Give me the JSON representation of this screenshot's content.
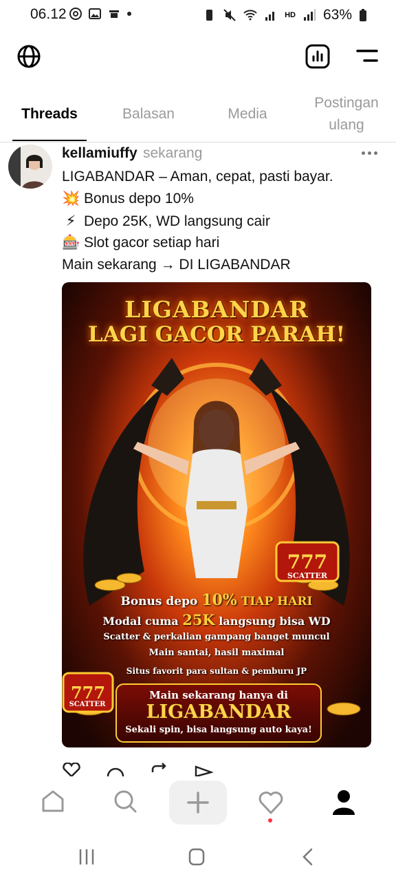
{
  "status_bar": {
    "time": "06.12",
    "battery": "63%",
    "network": "HD"
  },
  "tabs": [
    {
      "label": "Threads",
      "active": true
    },
    {
      "label": "Balasan",
      "active": false
    },
    {
      "label": "Media",
      "active": false
    },
    {
      "label": "Postingan ulang",
      "active": false
    }
  ],
  "post": {
    "username": "kellamiuffy",
    "timestamp": "sekarang",
    "lines": [
      {
        "emoji": "",
        "text": "LIGABANDAR – Aman, cepat, pasti bayar."
      },
      {
        "emoji": "💥",
        "text": "Bonus depo 10%"
      },
      {
        "emoji": "⚡",
        "text": "Depo 25K, WD langsung cair"
      },
      {
        "emoji": "🎰",
        "text": "Slot gacor setiap hari"
      },
      {
        "emoji": "",
        "text": "Main sekarang → DI LIGABANDAR"
      }
    ],
    "image": {
      "title_line1": "LIGABANDAR",
      "title_line2": "LAGI GACOR PARAH!",
      "scatter_label": "SCATTER",
      "promo_1a": "Bonus depo ",
      "promo_1b": "10%",
      "promo_1c": " TIAP HARI",
      "promo_2a": "Modal cuma ",
      "promo_2b": "25K",
      "promo_2c": " langsung bisa WD",
      "promo_3": "Scatter & perkalian gampang banget muncul",
      "promo_4": "Main santai, hasil maximal",
      "promo_5": "Situs favorit para sultan & pemburu JP",
      "cta_1": "Main sekarang hanya di",
      "cta_2": "LIGABANDAR",
      "cta_3": "Sekali spin, bisa langsung auto kaya!"
    }
  },
  "colors": {
    "accent_dot": "#ff3040",
    "text_secondary": "#9a9a9a"
  },
  "icons": [
    "globe-icon",
    "insights-icon",
    "menu-icon",
    "like-icon",
    "reply-icon",
    "repost-icon",
    "share-icon",
    "home-icon",
    "search-icon",
    "compose-icon",
    "heart-icon",
    "profile-icon"
  ]
}
